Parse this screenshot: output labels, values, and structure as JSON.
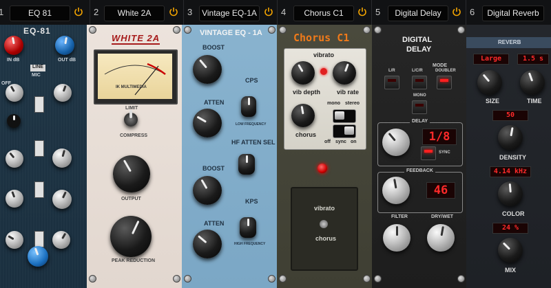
{
  "slots": [
    {
      "num": "1",
      "name": "EQ 81"
    },
    {
      "num": "2",
      "name": "White 2A"
    },
    {
      "num": "3",
      "name": "Vintage EQ-1A"
    },
    {
      "num": "4",
      "name": "Chorus C1"
    },
    {
      "num": "5",
      "name": "Digital Delay"
    },
    {
      "num": "6",
      "name": "Digital Reverb"
    }
  ],
  "power_color": "#f5a500",
  "eq81": {
    "title": "EQ-81",
    "in": "IN dB",
    "out": "OUT dB",
    "line": "LINE",
    "mic": "MIC",
    "off": "OFF"
  },
  "white2a": {
    "title": "WHITE 2A",
    "meter_brand": "IK MULTIMEDIA",
    "limit": "LIMIT",
    "compress": "COMPRESS",
    "output": "OUTPUT",
    "peak": "PEAK REDUCTION"
  },
  "vintage": {
    "title": "VINTAGE EQ - 1A",
    "boost1": "BOOST",
    "atten1": "ATTEN",
    "cps": "CPS",
    "low_freq": "LOW FREQUENCY",
    "hf_atten": "HF ATTEN SEL",
    "boost2": "BOOST",
    "atten2": "ATTEN",
    "kps": "KPS",
    "high_freq": "HIGH FREQUENCY"
  },
  "chorus": {
    "title": "Chorus C1",
    "vibrato": "vibrato",
    "vib_depth": "vib depth",
    "vib_rate": "vib rate",
    "chorus": "chorus",
    "mono": "mono",
    "stereo": "stereo",
    "off": "off",
    "sync": "sync",
    "on": "on",
    "pedal_vibrato": "vibrato",
    "pedal_chorus": "chorus"
  },
  "delay": {
    "title1": "DIGITAL",
    "title2": "DELAY",
    "mode": "MODE",
    "lr": "L/R",
    "lcr": "L/C/R",
    "doubler": "DOUBLER",
    "mono": "MONO",
    "delay": "DELAY",
    "delay_value": "1/8",
    "sync": "SYNC",
    "feedback": "FEEDBACK",
    "feedback_value": "46",
    "filter": "FILTER",
    "drywet": "DRY/WET"
  },
  "reverb": {
    "title": "REVERB",
    "size_value": "Large",
    "time_value": "1.5 s",
    "size": "SIZE",
    "time": "TIME",
    "density_value": "50",
    "density": "DENSITY",
    "color_value": "4.14 kHz",
    "color": "COLOR",
    "mix_value": "24 %",
    "mix": "MIX"
  }
}
